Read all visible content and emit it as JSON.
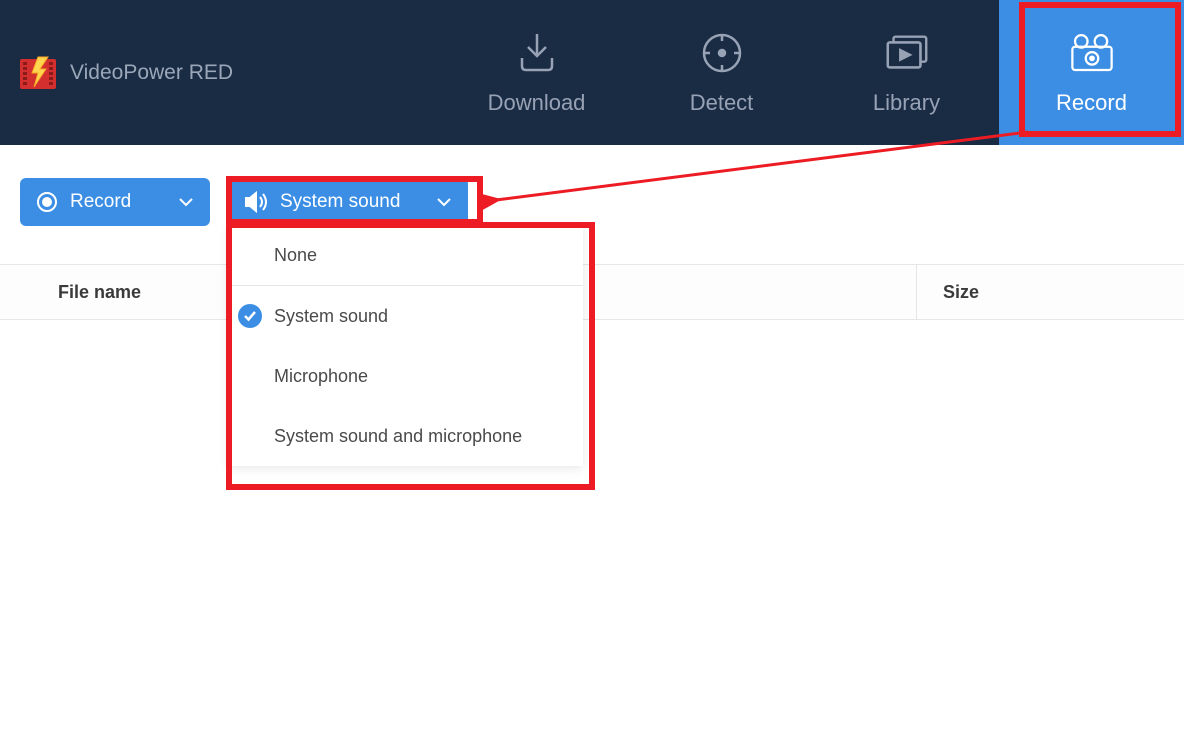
{
  "app": {
    "title": "VideoPower RED"
  },
  "nav": {
    "download": "Download",
    "detect": "Detect",
    "library": "Library",
    "record": "Record",
    "active": "record"
  },
  "toolbar": {
    "record_label": "Record",
    "audio_label": "System sound"
  },
  "dropdown": {
    "items": [
      {
        "label": "None",
        "checked": false
      },
      {
        "label": "System sound",
        "checked": true
      },
      {
        "label": "Microphone",
        "checked": false
      },
      {
        "label": "System sound and microphone",
        "checked": false
      }
    ]
  },
  "table": {
    "columns": {
      "filename": "File name",
      "size": "Size"
    }
  }
}
